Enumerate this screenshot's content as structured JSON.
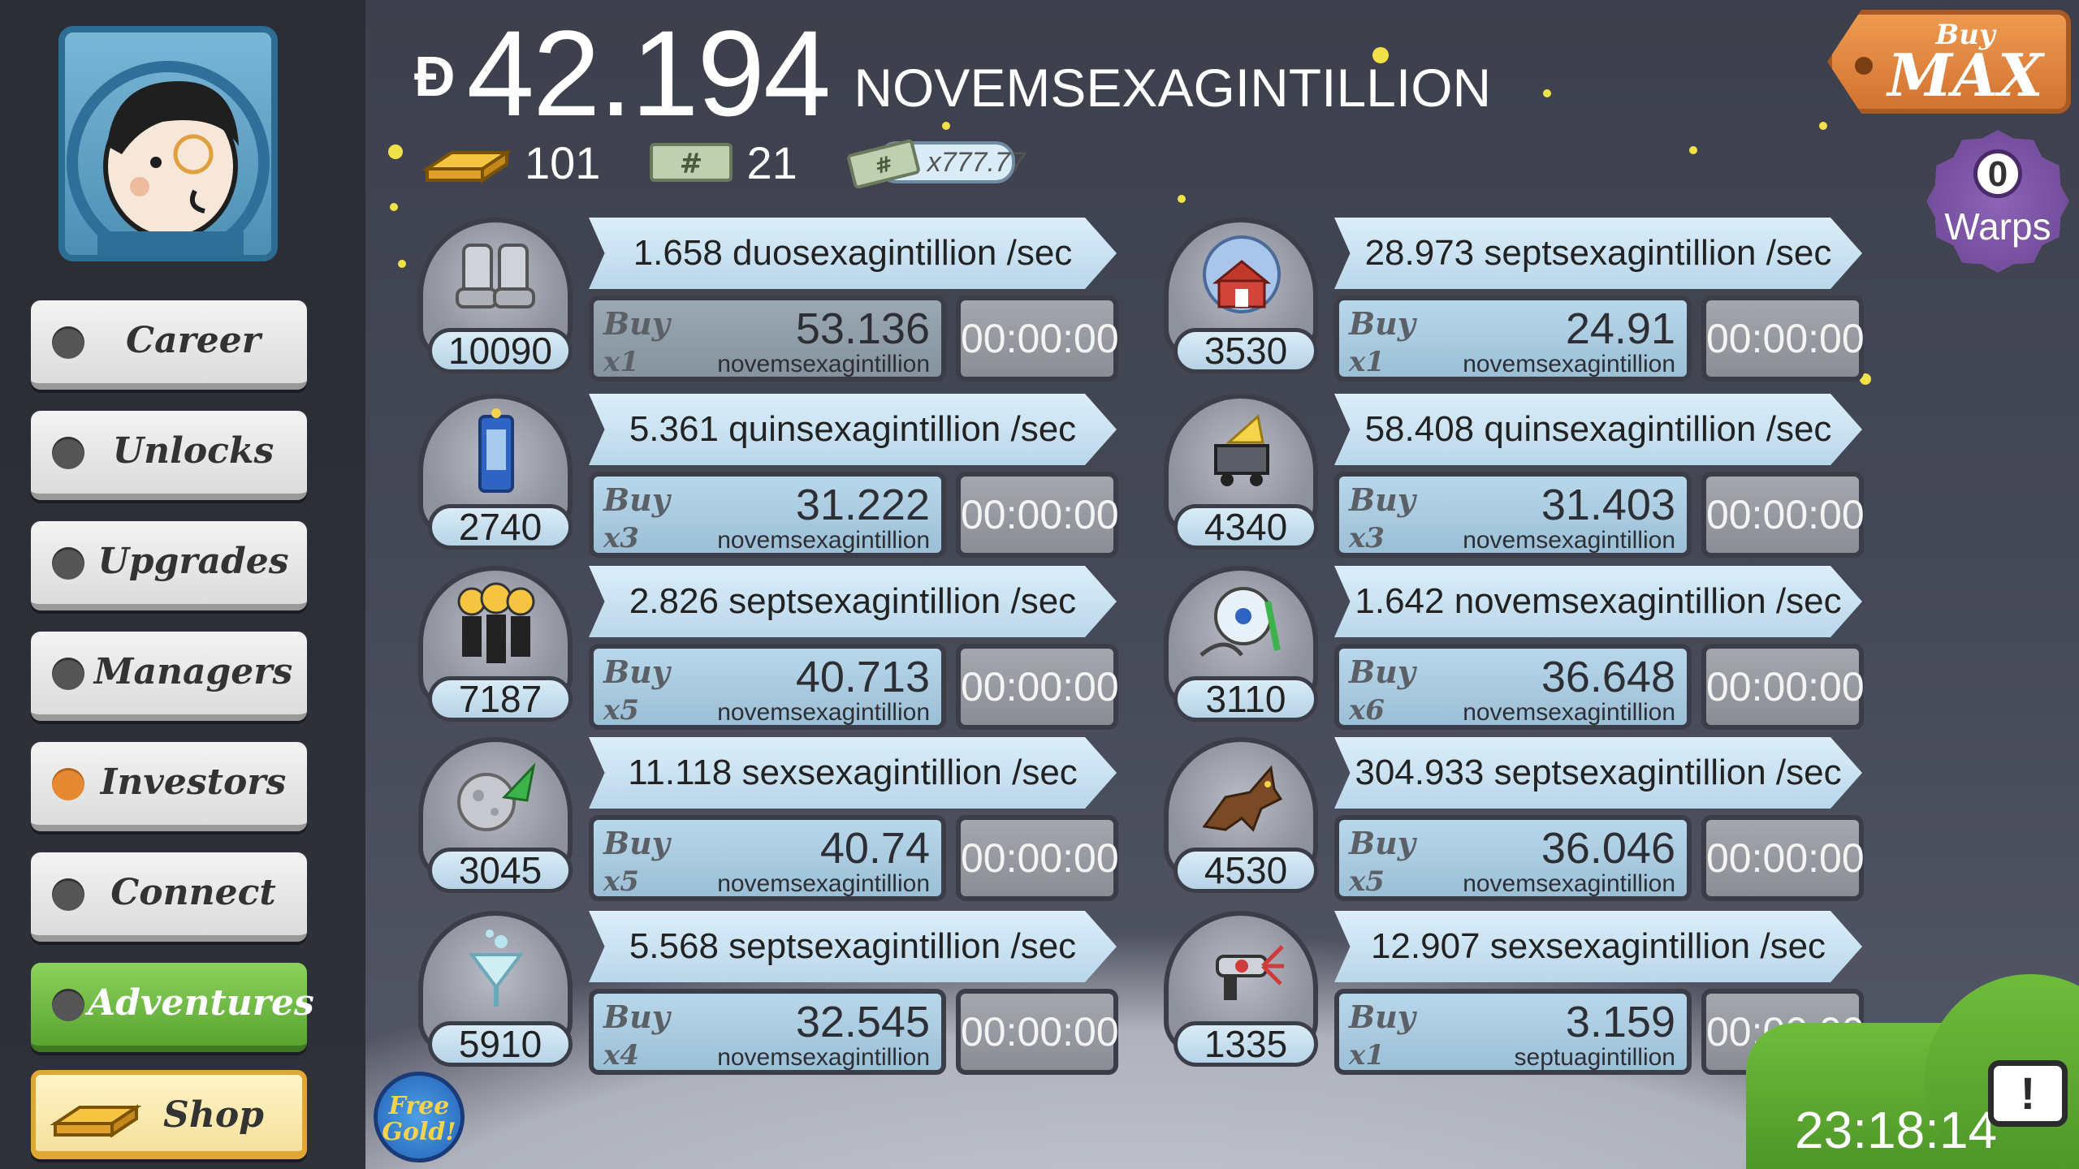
{
  "header": {
    "currency_symbol": "Ð",
    "money_value": "42.194",
    "money_unit": "NOVEMSEXAGINTILLION",
    "gold_bars": "101",
    "megabucks": "21",
    "multiplier_ticket": "x777.77"
  },
  "buy_max": {
    "small": "Buy",
    "big": "MAX"
  },
  "warps": {
    "count": "0",
    "label": "Warps"
  },
  "nav": [
    {
      "label": "Career"
    },
    {
      "label": "Unlocks"
    },
    {
      "label": "Upgrades"
    },
    {
      "label": "Managers"
    },
    {
      "label": "Investors"
    },
    {
      "label": "Connect"
    },
    {
      "label": "Adventures"
    },
    {
      "label": "Shop"
    }
  ],
  "businesses": [
    {
      "icon": "moon-boots-icon",
      "owned": "10090",
      "rate": "1.658 duosexagintillion /sec",
      "buy_word": "Buy",
      "buy_mult": "x1",
      "cost": "53.136",
      "cost_unit": "novemsexagintillion",
      "timer": "00:00:00",
      "affordable": false
    },
    {
      "icon": "barn-dome-icon",
      "owned": "3530",
      "rate": "28.973 septsexagintillion /sec",
      "buy_word": "Buy",
      "buy_mult": "x1",
      "cost": "24.91",
      "cost_unit": "novemsexagintillion",
      "timer": "00:00:00",
      "affordable": true
    },
    {
      "icon": "phone-booth-icon",
      "owned": "2740",
      "rate": "5.361 quinsexagintillion /sec",
      "buy_word": "Buy",
      "buy_mult": "x3",
      "cost": "31.222",
      "cost_unit": "novemsexagintillion",
      "timer": "00:00:00",
      "affordable": true
    },
    {
      "icon": "cheese-mine-cart-icon",
      "owned": "4340",
      "rate": "58.408 quinsexagintillion /sec",
      "buy_word": "Buy",
      "buy_mult": "x3",
      "cost": "31.403",
      "cost_unit": "novemsexagintillion",
      "timer": "00:00:00",
      "affordable": true
    },
    {
      "icon": "clones-icon",
      "owned": "7187",
      "rate": "2.826 septsexagintillion /sec",
      "buy_word": "Buy",
      "buy_mult": "x5",
      "cost": "40.713",
      "cost_unit": "novemsexagintillion",
      "timer": "00:00:00",
      "affordable": true
    },
    {
      "icon": "amusement-park-icon",
      "owned": "3110",
      "rate": "1.642 novemsexagintillion /sec",
      "buy_word": "Buy",
      "buy_mult": "x6",
      "cost": "36.648",
      "cost_unit": "novemsexagintillion",
      "timer": "00:00:00",
      "affordable": true
    },
    {
      "icon": "moon-rocket-icon",
      "owned": "3045",
      "rate": "11.118 sexsexagintillion /sec",
      "buy_word": "Buy",
      "buy_mult": "x5",
      "cost": "40.74",
      "cost_unit": "novemsexagintillion",
      "timer": "00:00:00",
      "affordable": true
    },
    {
      "icon": "werewolf-icon",
      "owned": "4530",
      "rate": "304.933 septsexagintillion /sec",
      "buy_word": "Buy",
      "buy_mult": "x5",
      "cost": "36.046",
      "cost_unit": "novemsexagintillion",
      "timer": "00:00:00",
      "affordable": true
    },
    {
      "icon": "martini-icon",
      "owned": "5910",
      "rate": "5.568 septsexagintillion /sec",
      "buy_word": "Buy",
      "buy_mult": "x4",
      "cost": "32.545",
      "cost_unit": "novemsexagintillion",
      "timer": "00:00:00",
      "affordable": true
    },
    {
      "icon": "ray-gun-icon",
      "owned": "1335",
      "rate": "12.907 sexsexagintillion /sec",
      "buy_word": "Buy",
      "buy_mult": "x1",
      "cost": "3.159",
      "cost_unit": "septuagintillion",
      "timer": "00:00:00",
      "affordable": true
    }
  ],
  "free_gold": {
    "line1": "Free",
    "line2": "Gold!"
  },
  "tv": {
    "timer": "23:18:14",
    "icon": "!"
  }
}
